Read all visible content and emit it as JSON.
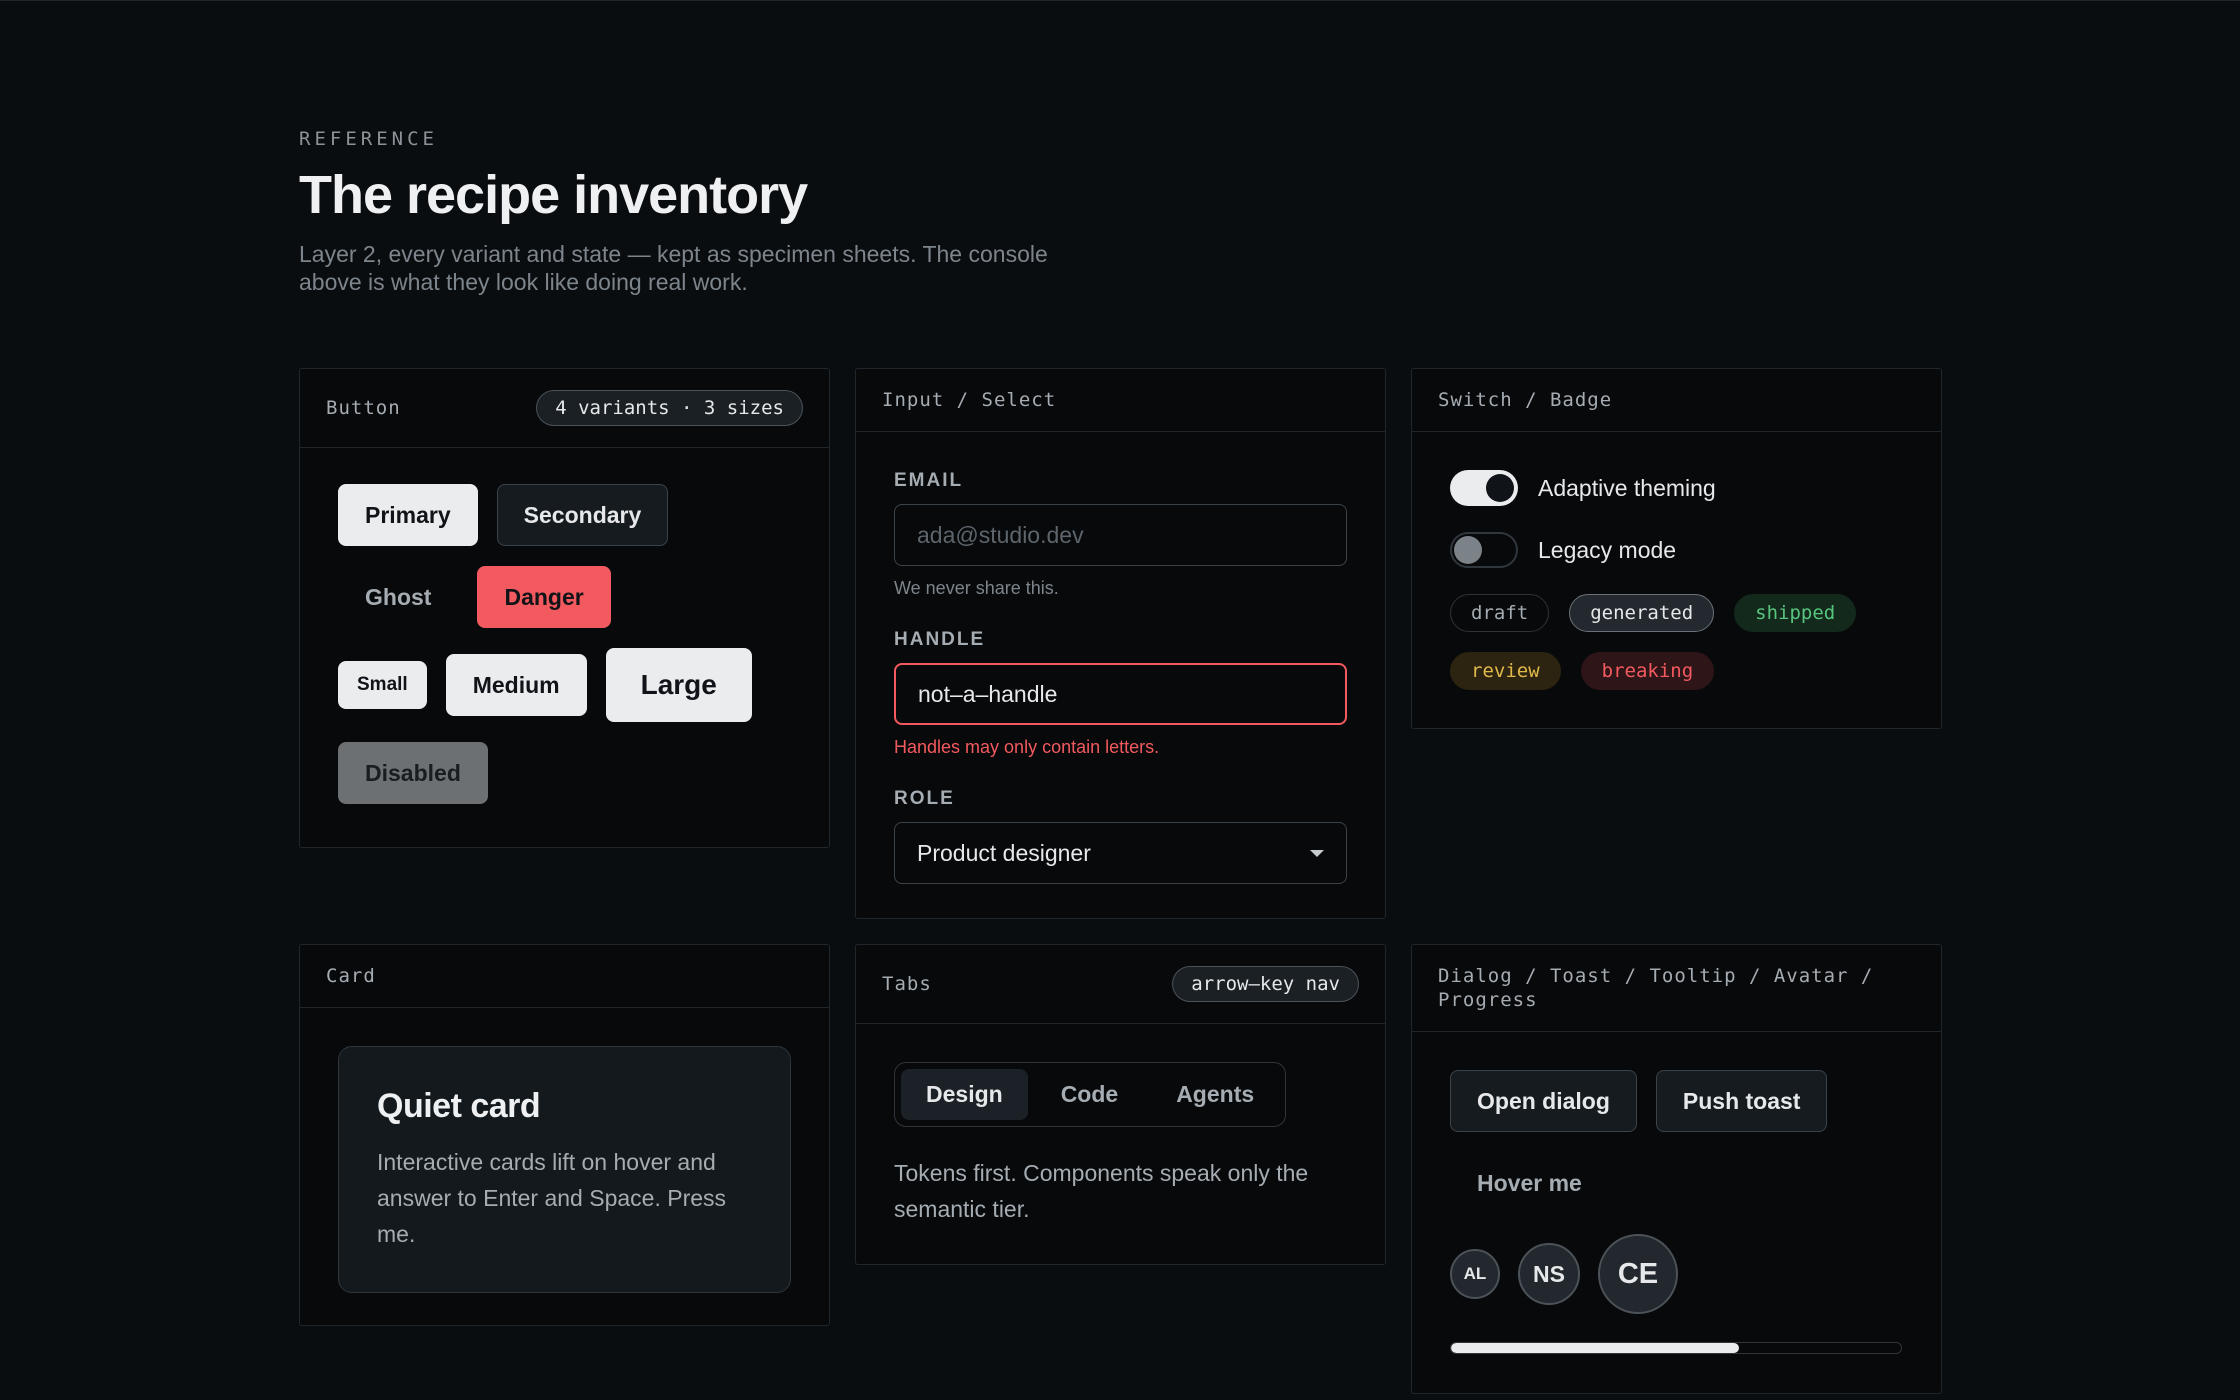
{
  "header": {
    "eyebrow": "REFERENCE",
    "title": "The recipe inventory",
    "subtitle": "Layer 2, every variant and state — kept as specimen sheets. The console above is what they look like doing real work."
  },
  "button_panel": {
    "title": "Button",
    "pill": "4 variants · 3 sizes",
    "primary": "Primary",
    "secondary": "Secondary",
    "ghost": "Ghost",
    "danger": "Danger",
    "small": "Small",
    "medium": "Medium",
    "large": "Large",
    "disabled": "Disabled"
  },
  "input_panel": {
    "title": "Input / Select",
    "email_label": "EMAIL",
    "email_placeholder": "ada@studio.dev",
    "email_hint": "We never share this.",
    "handle_label": "HANDLE",
    "handle_value": "not–a–handle",
    "handle_error": "Handles may only contain letters.",
    "role_label": "ROLE",
    "role_value": "Product designer"
  },
  "switch_panel": {
    "title": "Switch / Badge",
    "switches": [
      {
        "label": "Adaptive theming",
        "on": true
      },
      {
        "label": "Legacy mode",
        "on": false
      }
    ],
    "badges": [
      "draft",
      "generated",
      "shipped",
      "review",
      "breaking"
    ]
  },
  "card_panel": {
    "title": "Card",
    "card_title": "Quiet card",
    "card_body": "Interactive cards lift on hover and answer to Enter and Space. Press me."
  },
  "tabs_panel": {
    "title": "Tabs",
    "pill": "arrow–key nav",
    "tabs": [
      "Design",
      "Code",
      "Agents"
    ],
    "active_tab": "Design",
    "content": "Tokens first. Components speak only the semantic tier."
  },
  "overlay_panel": {
    "title": "Dialog / Toast / Tooltip / Avatar / Progress",
    "open_dialog": "Open dialog",
    "push_toast": "Push toast",
    "hover_me": "Hover me",
    "avatars": [
      "AL",
      "NS",
      "CE"
    ],
    "progress": 0.64
  },
  "colors": {
    "background": "#0a0d10",
    "panel": "#07090b",
    "danger": "#f25a5f",
    "success": "#58c47e",
    "warning": "#e0b94a"
  }
}
